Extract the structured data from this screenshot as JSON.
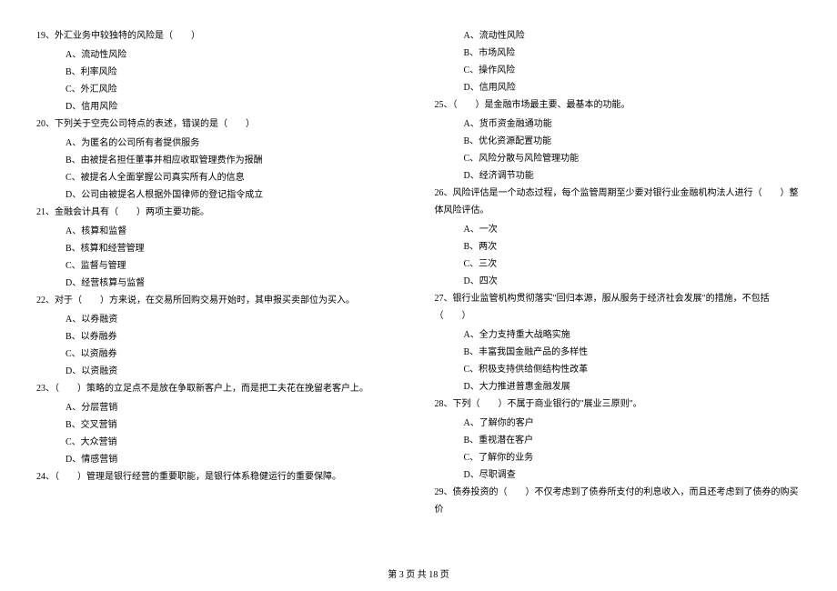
{
  "left_column": [
    {
      "type": "q",
      "text": "19、外汇业务中较独特的风险是（　　）"
    },
    {
      "type": "o",
      "text": "A、流动性风险"
    },
    {
      "type": "o",
      "text": "B、利率风险"
    },
    {
      "type": "o",
      "text": "C、外汇风险"
    },
    {
      "type": "o",
      "text": "D、信用风险"
    },
    {
      "type": "q",
      "text": "20、下列关于空壳公司特点的表述，错误的是（　　）"
    },
    {
      "type": "o",
      "text": "A、为匿名的公司所有者提供服务"
    },
    {
      "type": "o",
      "text": "B、由被提名担任董事并相应收取管理费作为报酬"
    },
    {
      "type": "o",
      "text": "C、被提名人全面掌握公司真实所有人的信息"
    },
    {
      "type": "o",
      "text": "D、公司由被提名人根据外国律师的登记指令成立"
    },
    {
      "type": "q",
      "text": "21、金融会计具有（　　）两项主要功能。"
    },
    {
      "type": "o",
      "text": "A、核算和监督"
    },
    {
      "type": "o",
      "text": "B、核算和经营管理"
    },
    {
      "type": "o",
      "text": "C、监督与管理"
    },
    {
      "type": "o",
      "text": "D、经营核算与监督"
    },
    {
      "type": "q",
      "text": "22、对于（　　）方来说，在交易所回购交易开始时，其申报买卖部位为买入。"
    },
    {
      "type": "o",
      "text": "A、以券融资"
    },
    {
      "type": "o",
      "text": "B、以券融券"
    },
    {
      "type": "o",
      "text": "C、以资融券"
    },
    {
      "type": "o",
      "text": "D、以资融资"
    },
    {
      "type": "q",
      "text": "23、（　　）策略的立足点不是放在争取新客户上，而是把工夫花在挽留老客户上。"
    },
    {
      "type": "o",
      "text": "A、分层营销"
    },
    {
      "type": "o",
      "text": "B、交叉营销"
    },
    {
      "type": "o",
      "text": "C、大众营销"
    },
    {
      "type": "o",
      "text": "D、情感营销"
    },
    {
      "type": "q",
      "text": "24、（　　）管理是银行经营的重要职能，是银行体系稳健运行的重要保障。"
    }
  ],
  "right_column": [
    {
      "type": "o",
      "text": "A、流动性风险"
    },
    {
      "type": "o",
      "text": "B、市场风险"
    },
    {
      "type": "o",
      "text": "C、操作风险"
    },
    {
      "type": "o",
      "text": "D、信用风险"
    },
    {
      "type": "q",
      "text": "25、（　　）是金融市场最主要、最基本的功能。"
    },
    {
      "type": "o",
      "text": "A、货币资金融通功能"
    },
    {
      "type": "o",
      "text": "B、优化资源配置功能"
    },
    {
      "type": "o",
      "text": "C、风险分散与风险管理功能"
    },
    {
      "type": "o",
      "text": "D、经济调节功能"
    },
    {
      "type": "q",
      "text": "26、风险评估是一个动态过程，每个监管周期至少要对银行业金融机构法人进行（　　）整体风险评估。"
    },
    {
      "type": "o",
      "text": "A、一次"
    },
    {
      "type": "o",
      "text": "B、两次"
    },
    {
      "type": "o",
      "text": "C、三次"
    },
    {
      "type": "o",
      "text": "D、四次"
    },
    {
      "type": "q",
      "text": "27、银行业监管机构贯彻落实\"回归本源，服从服务于经济社会发展\"的措施，不包括（　　）"
    },
    {
      "type": "o",
      "text": "A、全力支持重大战略实施"
    },
    {
      "type": "o",
      "text": "B、丰富我国金融产品的多样性"
    },
    {
      "type": "o",
      "text": "C、积极支持供给侧结构性改革"
    },
    {
      "type": "o",
      "text": "D、大力推进普惠金融发展"
    },
    {
      "type": "q",
      "text": "28、下列（　　）不属于商业银行的\"展业三原则\"。"
    },
    {
      "type": "o",
      "text": "A、了解你的客户"
    },
    {
      "type": "o",
      "text": "B、重视潜在客户"
    },
    {
      "type": "o",
      "text": "C、了解你的业务"
    },
    {
      "type": "o",
      "text": "D、尽职调查"
    },
    {
      "type": "q",
      "text": "29、债券投资的（　　）不仅考虑到了债券所支付的利息收入，而且还考虑到了债券的购买价"
    }
  ],
  "footer": "第 3 页 共 18 页"
}
